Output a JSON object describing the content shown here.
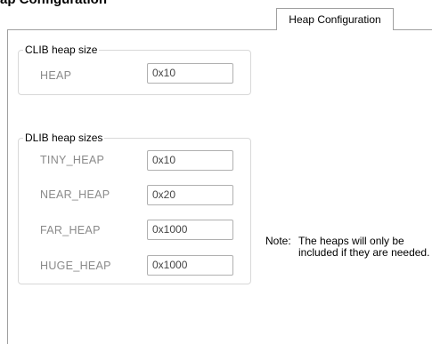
{
  "header": {
    "partial_text": "ap Configuration"
  },
  "tab": {
    "label": "Heap Configuration"
  },
  "clib": {
    "title": "CLIB heap size",
    "rows": [
      {
        "label": "HEAP",
        "value": "0x10"
      }
    ]
  },
  "dlib": {
    "title": "DLIB heap sizes",
    "rows": [
      {
        "label": "TINY_HEAP",
        "value": "0x10"
      },
      {
        "label": "NEAR_HEAP",
        "value": "0x20"
      },
      {
        "label": "FAR_HEAP",
        "value": "0x1000"
      },
      {
        "label": "HUGE_HEAP",
        "value": "0x1000"
      }
    ]
  },
  "note": {
    "prefix": "Note:",
    "text": "The heaps will only be included if they are needed."
  }
}
